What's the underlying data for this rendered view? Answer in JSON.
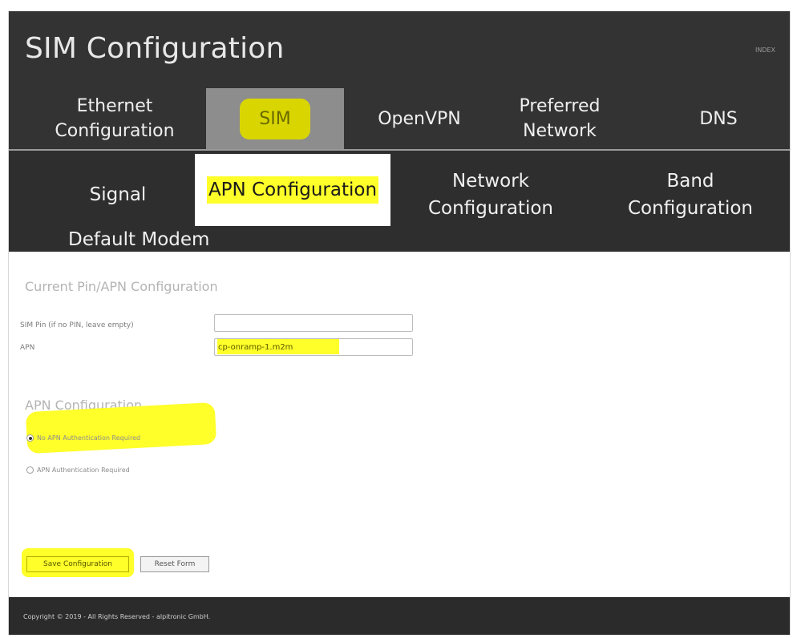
{
  "page": {
    "title": "SIM Configuration",
    "top_right_text": "INDEX"
  },
  "main_tabs": [
    {
      "label_line1": "Ethernet",
      "label_line2": "Configuration"
    },
    {
      "label": "SIM"
    },
    {
      "label": "OpenVPN"
    },
    {
      "label_line1": "Preferred",
      "label_line2": "Network"
    },
    {
      "label": "DNS"
    }
  ],
  "sub_tabs": [
    {
      "label": "Signal"
    },
    {
      "label": "APN Configuration"
    },
    {
      "label_line1": "Network",
      "label_line2": "Configuration"
    },
    {
      "label_line1": "Band",
      "label_line2": "Configuration"
    },
    {
      "label": "Default Modem"
    }
  ],
  "current_config": {
    "heading": "Current Pin/APN Configuration",
    "sim_pin_label": "SIM Pin (if no PIN, leave empty)",
    "sim_pin_value": "",
    "apn_label": "APN",
    "apn_value": "cp-onramp-1.m2m"
  },
  "apn_config": {
    "heading": "APN Configuration",
    "options": [
      {
        "label": "No APN Authentication Required",
        "checked": true
      },
      {
        "label": "APN Authentication Required",
        "checked": false
      }
    ]
  },
  "buttons": {
    "save": "Save Configuration",
    "reset": "Reset Form"
  },
  "footer": {
    "copyright": "Copyright © 2019 - All Rights Reserved - alpitronic GmbH."
  },
  "colors": {
    "header_bg": "#333333",
    "highlight_yellow": "#ffff2a",
    "highlight_olive": "#d9d500"
  }
}
